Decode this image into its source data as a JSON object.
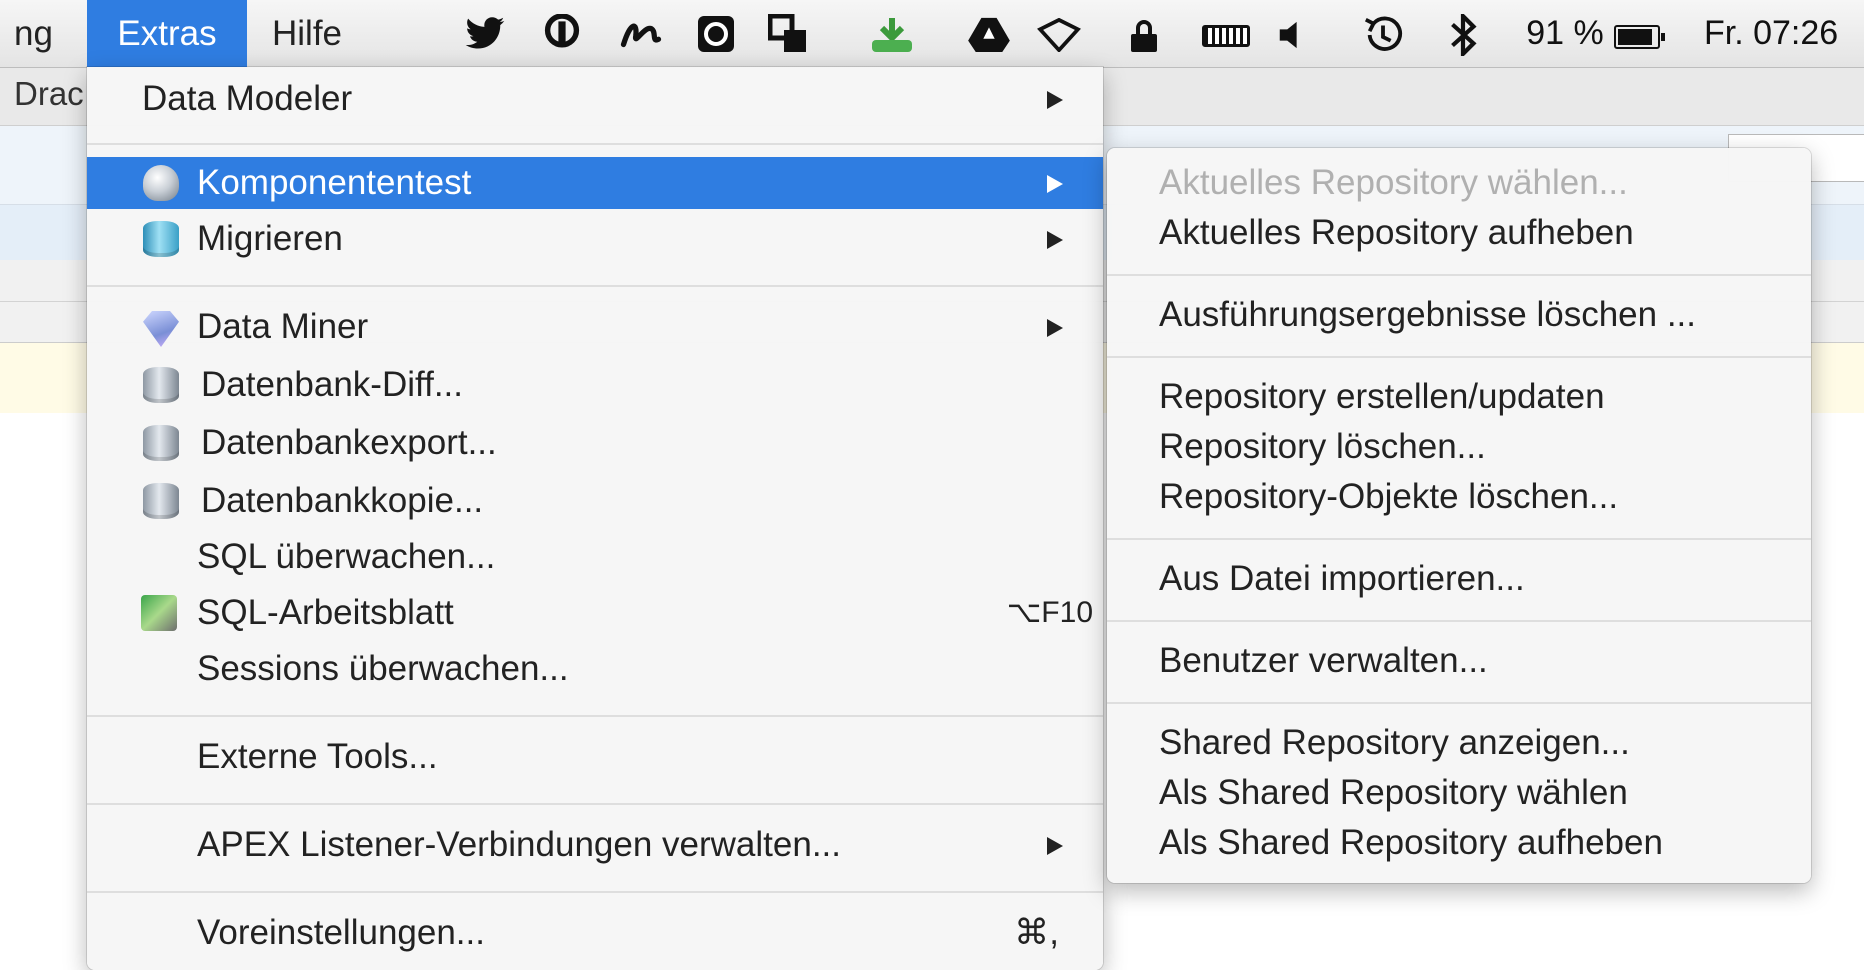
{
  "menubar": {
    "partial_left_label": "ng",
    "menus": [
      {
        "label": "Extras"
      },
      {
        "label": "Hilfe"
      }
    ],
    "status": {
      "battery_percent": "91 %",
      "clock": "Fr. 07:26"
    }
  },
  "app": {
    "partial_title": "Drac"
  },
  "extras_menu": {
    "items": [
      {
        "label": "Data Modeler",
        "submenu": true
      },
      {
        "label": "Komponententest",
        "submenu": true,
        "highlighted": true
      },
      {
        "label": "Migrieren",
        "submenu": true
      },
      {
        "label": "Data Miner",
        "submenu": true
      },
      {
        "label": "Datenbank-Diff..."
      },
      {
        "label": "Datenbankexport..."
      },
      {
        "label": "Datenbankkopie..."
      },
      {
        "label": "SQL überwachen..."
      },
      {
        "label": "SQL-Arbeitsblatt",
        "shortcut": "⌥F10"
      },
      {
        "label": "Sessions überwachen..."
      },
      {
        "label": "Externe Tools..."
      },
      {
        "label": "APEX Listener-Verbindungen verwalten...",
        "submenu": true
      },
      {
        "label": "Voreinstellungen...",
        "shortcut": "⌘,"
      }
    ]
  },
  "komponententest_submenu": {
    "items": [
      {
        "label": "Aktuelles Repository wählen...",
        "disabled": true
      },
      {
        "label": "Aktuelles Repository aufheben"
      },
      {
        "label": "Ausführungsergebnisse löschen ..."
      },
      {
        "label": "Repository erstellen/updaten"
      },
      {
        "label": "Repository löschen..."
      },
      {
        "label": "Repository-Objekte löschen..."
      },
      {
        "label": "Aus Datei importieren..."
      },
      {
        "label": "Benutzer verwalten..."
      },
      {
        "label": "Shared Repository anzeigen..."
      },
      {
        "label": "Als Shared Repository wählen"
      },
      {
        "label": "Als Shared Repository aufheben"
      }
    ]
  },
  "colors": {
    "highlight": "#2f7de1",
    "disabled_text": "#b0b0b0"
  }
}
